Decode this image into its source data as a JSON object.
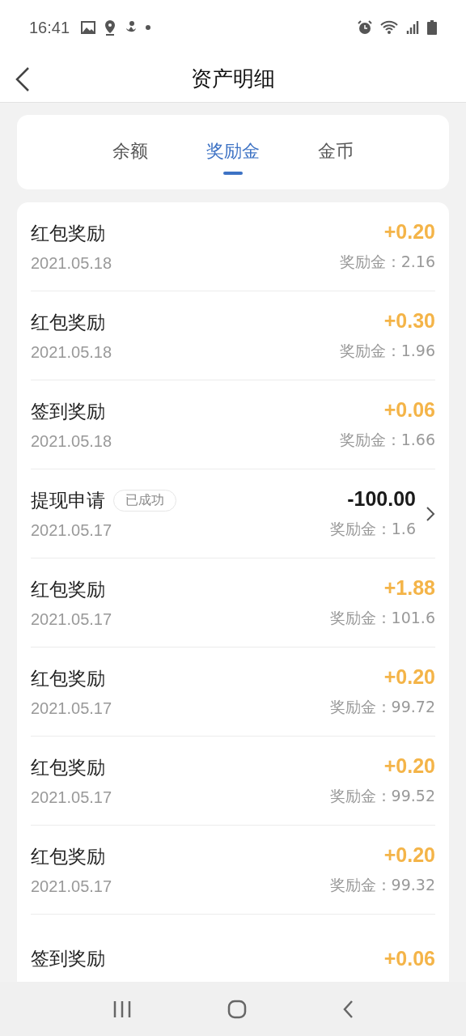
{
  "status_bar": {
    "time": "16:41"
  },
  "header": {
    "title": "资产明细"
  },
  "tabs": [
    {
      "label": "余额",
      "selected": false
    },
    {
      "label": "奖励金",
      "selected": true
    },
    {
      "label": "金币",
      "selected": false
    }
  ],
  "records": [
    {
      "kind": "reward",
      "title": "红包奖励",
      "date": "2021.05.18",
      "amount": "+0.20",
      "balance": "奖励金：2.16"
    },
    {
      "kind": "reward",
      "title": "红包奖励",
      "date": "2021.05.18",
      "amount": "+0.30",
      "balance": "奖励金：1.96"
    },
    {
      "kind": "reward",
      "title": "签到奖励",
      "date": "2021.05.18",
      "amount": "+0.06",
      "balance": "奖励金：1.66"
    },
    {
      "kind": "withdrawal",
      "title": "提现申请",
      "badge": "已成功",
      "date": "2021.05.17",
      "amount": "-100.00",
      "balance": "奖励金：1.6"
    },
    {
      "kind": "reward",
      "title": "红包奖励",
      "date": "2021.05.17",
      "amount": "+1.88",
      "balance": "奖励金：101.6"
    },
    {
      "kind": "reward",
      "title": "红包奖励",
      "date": "2021.05.17",
      "amount": "+0.20",
      "balance": "奖励金：99.72"
    },
    {
      "kind": "reward",
      "title": "红包奖励",
      "date": "2021.05.17",
      "amount": "+0.20",
      "balance": "奖励金：99.52"
    },
    {
      "kind": "reward",
      "title": "红包奖励",
      "date": "2021.05.17",
      "amount": "+0.20",
      "balance": "奖励金：99.32"
    },
    {
      "kind": "reward",
      "title": "签到奖励",
      "amount": "+0.06"
    }
  ]
}
